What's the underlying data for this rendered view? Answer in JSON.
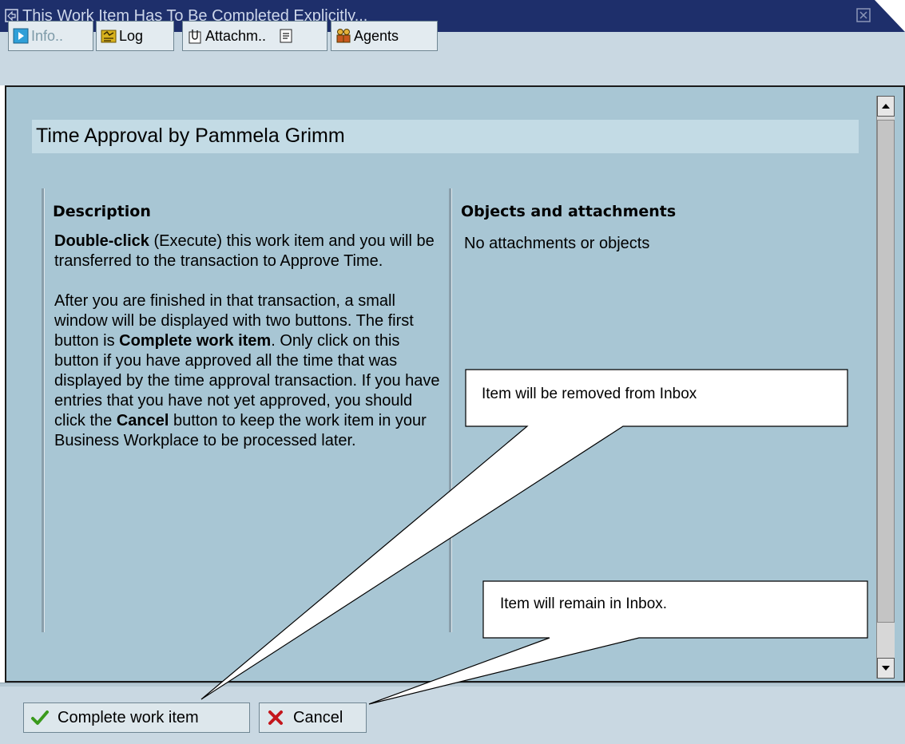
{
  "window": {
    "title": "This Work Item Has To Be Completed Explicitly..."
  },
  "tabs": [
    {
      "label": "Info..",
      "icon": "play-icon",
      "state": "inactive"
    },
    {
      "label": "Log",
      "icon": "log-icon",
      "state": "active"
    },
    {
      "label": "Attachm..",
      "icon": "paperclip-icon",
      "state": "active"
    },
    {
      "label": "",
      "icon": "notes-icon",
      "state": "active"
    },
    {
      "label": "Agents",
      "icon": "agents-icon",
      "state": "active"
    }
  ],
  "content": {
    "title": "Time Approval by Pammela Grimm",
    "description": {
      "heading": "Description",
      "p1_bold": "Double-click",
      "p1_text": " (Execute) this work item and you will be transferred to the transaction to Approve Time.",
      "p2_a": "After you are finished in that transaction, a small window will be displayed with two buttons. The first button is ",
      "p2_bold1": "Complete work item",
      "p2_b": ". Only click on this button if you have approved all the time that was displayed by the time approval transaction. If you have entries that you have not yet approved, you should click the ",
      "p2_bold2": "Cancel",
      "p2_c": " button to keep the work item in your Business Workplace to be processed later."
    },
    "objects": {
      "heading": "Objects and attachments",
      "text": "No attachments or objects"
    }
  },
  "buttons": {
    "complete_label": "Complete work item",
    "cancel_label": "Cancel"
  },
  "callouts": {
    "complete_note": "Item will be removed from Inbox",
    "cancel_note": "Item will remain in Inbox."
  },
  "colors": {
    "titlebar": "#1e2f6b",
    "panel": "#a8c6d4",
    "header_band": "#c3dbe5",
    "check_green": "#3a9a1c",
    "cancel_red": "#c4161c"
  }
}
